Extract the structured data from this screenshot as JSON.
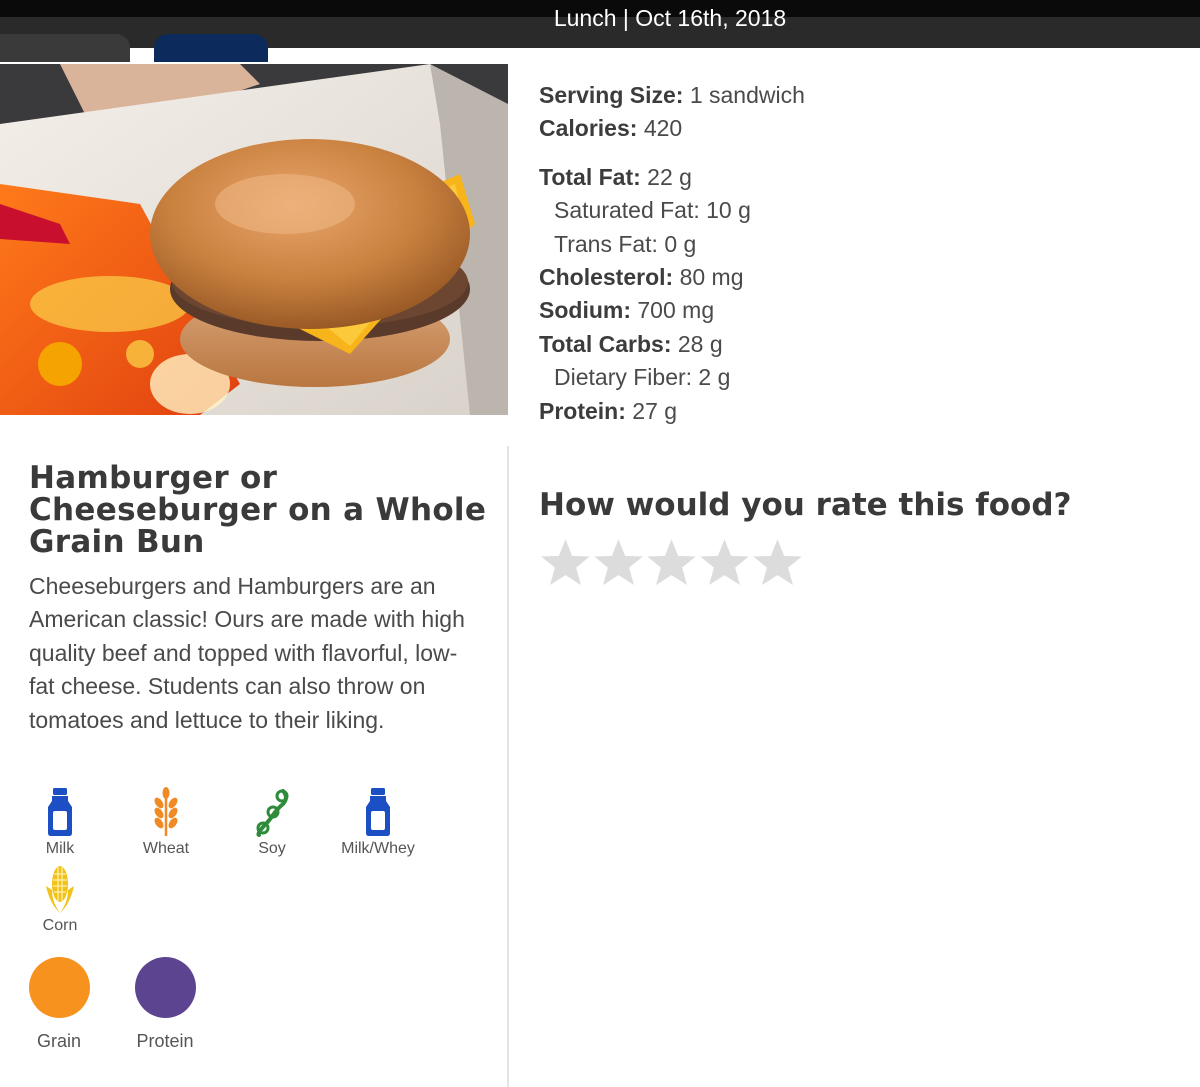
{
  "header": {
    "title": "Lunch | Oct 16th, 2018"
  },
  "food": {
    "name": "Hamburger or Cheeseburger on a Whole Grain Bun",
    "description": "Cheeseburgers and Hamburgers are an American classic! Ours are made with high quality beef and topped with flavorful, low-fat cheese. Students can also throw on tomatoes and lettuce to their liking."
  },
  "nutrition": {
    "serving_size": {
      "label": "Serving Size:",
      "value": " 1 sandwich"
    },
    "calories": {
      "label": "Calories:",
      "value": " 420"
    },
    "total_fat": {
      "label": "Total Fat:",
      "value": " 22 g"
    },
    "saturated_fat": {
      "label": "Saturated Fat:",
      "value": " 10 g"
    },
    "trans_fat": {
      "label": "Trans Fat:",
      "value": " 0 g"
    },
    "cholesterol": {
      "label": "Cholesterol:",
      "value": " 80 mg"
    },
    "sodium": {
      "label": "Sodium:",
      "value": " 700 mg"
    },
    "total_carbs": {
      "label": "Total Carbs:",
      "value": " 28 g"
    },
    "dietary_fiber": {
      "label": "Dietary Fiber:",
      "value": " 2 g"
    },
    "protein": {
      "label": "Protein:",
      "value": " 27 g"
    }
  },
  "allergens": [
    {
      "label": "Milk",
      "icon": "milk-bottle-icon",
      "color": "#1d4fc4"
    },
    {
      "label": "Wheat",
      "icon": "wheat-icon",
      "color": "#f08a24"
    },
    {
      "label": "Soy",
      "icon": "soybean-icon",
      "color": "#2e8b3a"
    },
    {
      "label": "Milk/Whey",
      "icon": "milk-bottle-icon",
      "color": "#1d4fc4"
    },
    {
      "label": "Corn",
      "icon": "corn-icon",
      "color": "#f2c21b"
    }
  ],
  "food_groups": [
    {
      "label": "Grain",
      "color": "#f7921e"
    },
    {
      "label": "Protein",
      "color": "#5c4491"
    }
  ],
  "rating": {
    "question": "How would you rate this food?",
    "max_stars": 5,
    "selected_stars": 0,
    "star_color": "#dcdcdc"
  }
}
